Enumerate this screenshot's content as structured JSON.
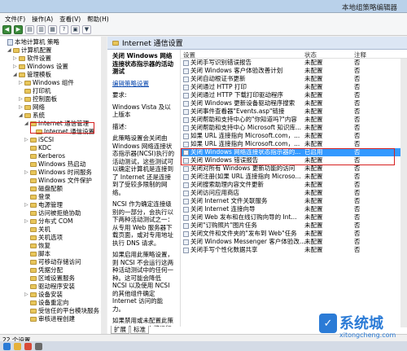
{
  "window": {
    "title": "本地组策略编辑器"
  },
  "menu": [
    "文件(F)",
    "操作(A)",
    "查看(V)",
    "帮助(H)"
  ],
  "tree": [
    {
      "label": "本地计算机 策略",
      "depth": 0,
      "exp": ""
    },
    {
      "label": "计算机配置",
      "depth": 1,
      "exp": "◢"
    },
    {
      "label": "软件设置",
      "depth": 2,
      "exp": "▷"
    },
    {
      "label": "Windows 设置",
      "depth": 2,
      "exp": "▷"
    },
    {
      "label": "管理模板",
      "depth": 2,
      "exp": "◢"
    },
    {
      "label": "Windows 组件",
      "depth": 3,
      "exp": "▷"
    },
    {
      "label": "打印机",
      "depth": 3,
      "exp": ""
    },
    {
      "label": "控制面板",
      "depth": 3,
      "exp": "▷"
    },
    {
      "label": "网络",
      "depth": 3,
      "exp": "▷"
    },
    {
      "label": "系统",
      "depth": 3,
      "exp": "◢"
    },
    {
      "label": "Internet 通信管理",
      "depth": 4,
      "exp": "◢"
    },
    {
      "label": "Internet 通信设置",
      "depth": 5,
      "exp": ""
    },
    {
      "label": "iSCSI",
      "depth": 4,
      "exp": "▷"
    },
    {
      "label": "KDC",
      "depth": 4,
      "exp": ""
    },
    {
      "label": "Kerberos",
      "depth": 4,
      "exp": ""
    },
    {
      "label": "Windows 热启动",
      "depth": 4,
      "exp": ""
    },
    {
      "label": "Windows 时间服务",
      "depth": 4,
      "exp": "▷"
    },
    {
      "label": "Windows 文件保护",
      "depth": 4,
      "exp": ""
    },
    {
      "label": "磁盘配额",
      "depth": 4,
      "exp": ""
    },
    {
      "label": "登录",
      "depth": 4,
      "exp": ""
    },
    {
      "label": "电源管理",
      "depth": 4,
      "exp": "▷"
    },
    {
      "label": "访问被拒绝协助",
      "depth": 4,
      "exp": ""
    },
    {
      "label": "分布式 COM",
      "depth": 4,
      "exp": "▷"
    },
    {
      "label": "关机",
      "depth": 4,
      "exp": ""
    },
    {
      "label": "关机选项",
      "depth": 4,
      "exp": ""
    },
    {
      "label": "恢复",
      "depth": 4,
      "exp": ""
    },
    {
      "label": "脚本",
      "depth": 4,
      "exp": ""
    },
    {
      "label": "可移动存储访问",
      "depth": 4,
      "exp": ""
    },
    {
      "label": "凭据分配",
      "depth": 4,
      "exp": ""
    },
    {
      "label": "区域设置服务",
      "depth": 4,
      "exp": ""
    },
    {
      "label": "驱动程序安装",
      "depth": 4,
      "exp": ""
    },
    {
      "label": "设备安装",
      "depth": 4,
      "exp": "▷"
    },
    {
      "label": "设备重定向",
      "depth": 4,
      "exp": ""
    },
    {
      "label": "受信任的平台模块服务",
      "depth": 4,
      "exp": ""
    },
    {
      "label": "审核进程创建",
      "depth": 4,
      "exp": ""
    }
  ],
  "detail": {
    "header": "Internet 通信设置",
    "desc": {
      "title": "关闭 Windows 网络连接状态指示器的活动测试",
      "edit_link": "编辑策略设置",
      "req_label": "要求:",
      "req_text": "Windows Vista 及以上版本",
      "desc_label": "描述:",
      "desc_text": "此策略设置会关闭由 Windows 网络连接状态指示器(NCSI)执行的活动测试，这些测试可以确定计算机是连接到了 Internet 还是连接到了受较多限制的网络。",
      "desc_text2": "NCSI 作为确定连接级别的一部分，会执行以下两种活动测试之一：从专用 Web 服务器下载页面，或对专用地址执行 DNS 请求。",
      "desc_text3": "如果启用此策略设置，则 NCSI 不会运行这两种活动测试中的任何一种。这可能会降低 NCSI 以及使用 NCSI 的其他组件确定 Internet 访问的能力。",
      "desc_text4": "如果禁用或未配置此策略设置，NCSI 将运行"
    },
    "columns": {
      "setting": "设置",
      "state": "状态",
      "comment": "注释"
    },
    "rows": [
      {
        "name": "关闭手写识别错误报告",
        "state": "未配置",
        "comment": "否"
      },
      {
        "name": "关闭 Windows 客户体验改善计划",
        "state": "未配置",
        "comment": "否"
      },
      {
        "name": "关闭自动根证书更新",
        "state": "未配置",
        "comment": "否"
      },
      {
        "name": "关闭通过 HTTP 打印",
        "state": "未配置",
        "comment": "否"
      },
      {
        "name": "关闭通过 HTTP 下载打印驱动程序",
        "state": "未配置",
        "comment": "否"
      },
      {
        "name": "关闭 Windows 更新设备驱动程序搜索",
        "state": "未配置",
        "comment": "否"
      },
      {
        "name": "关闭事件查看器\"Events.asp\"链接",
        "state": "未配置",
        "comment": "否"
      },
      {
        "name": "关闭帮助和支持中心的\"你知道吗?\"内容",
        "state": "未配置",
        "comment": "否"
      },
      {
        "name": "关闭帮助和支持中心 Microsoft 知识库...",
        "state": "未配置",
        "comment": "否"
      },
      {
        "name": "如果 URL 连接指向 Microsoft.com，...",
        "state": "未配置",
        "comment": "否"
      },
      {
        "name": "如果 URL 连接指向 Microsoft.com，...",
        "state": "未配置",
        "comment": "否"
      },
      {
        "name": "关闭 Windows 网络连接状态指示器的...",
        "state": "已启用",
        "comment": "否",
        "selected": true
      },
      {
        "name": "关闭 Windows 错误报告",
        "state": "未配置",
        "comment": "否"
      },
      {
        "name": "关闭对所有 Windows 更新功能的访问",
        "state": "未配置",
        "comment": "否"
      },
      {
        "name": "关闭注册(如果 URL 连接指向 Microso...",
        "state": "未配置",
        "comment": "否"
      },
      {
        "name": "关闭搜索助理内容文件更新",
        "state": "未配置",
        "comment": "否"
      },
      {
        "name": "关闭访问应用商店",
        "state": "未配置",
        "comment": "否"
      },
      {
        "name": "关闭 Internet 文件关联服务",
        "state": "未配置",
        "comment": "否"
      },
      {
        "name": "关闭 Internet 连接向导",
        "state": "未配置",
        "comment": "否"
      },
      {
        "name": "关闭 Web 发布和在线订购向导的 Int...",
        "state": "未配置",
        "comment": "否"
      },
      {
        "name": "关闭\"订购照片\"图片任务",
        "state": "未配置",
        "comment": "否"
      },
      {
        "name": "关闭文件和文件夹的\"发布到 Web\"任务",
        "state": "未配置",
        "comment": "否"
      },
      {
        "name": "关闭 Windows Messenger 客户体验改...",
        "state": "未配置",
        "comment": "否"
      },
      {
        "name": "关闭手写个性化数据共享",
        "state": "未配置",
        "comment": "否"
      }
    ],
    "tabs": [
      "扩展",
      "标准"
    ]
  },
  "status": {
    "count": "22 个设置"
  },
  "watermark": {
    "brand": "系统城",
    "url": "xitongcheng.com",
    "logo": "✓"
  }
}
